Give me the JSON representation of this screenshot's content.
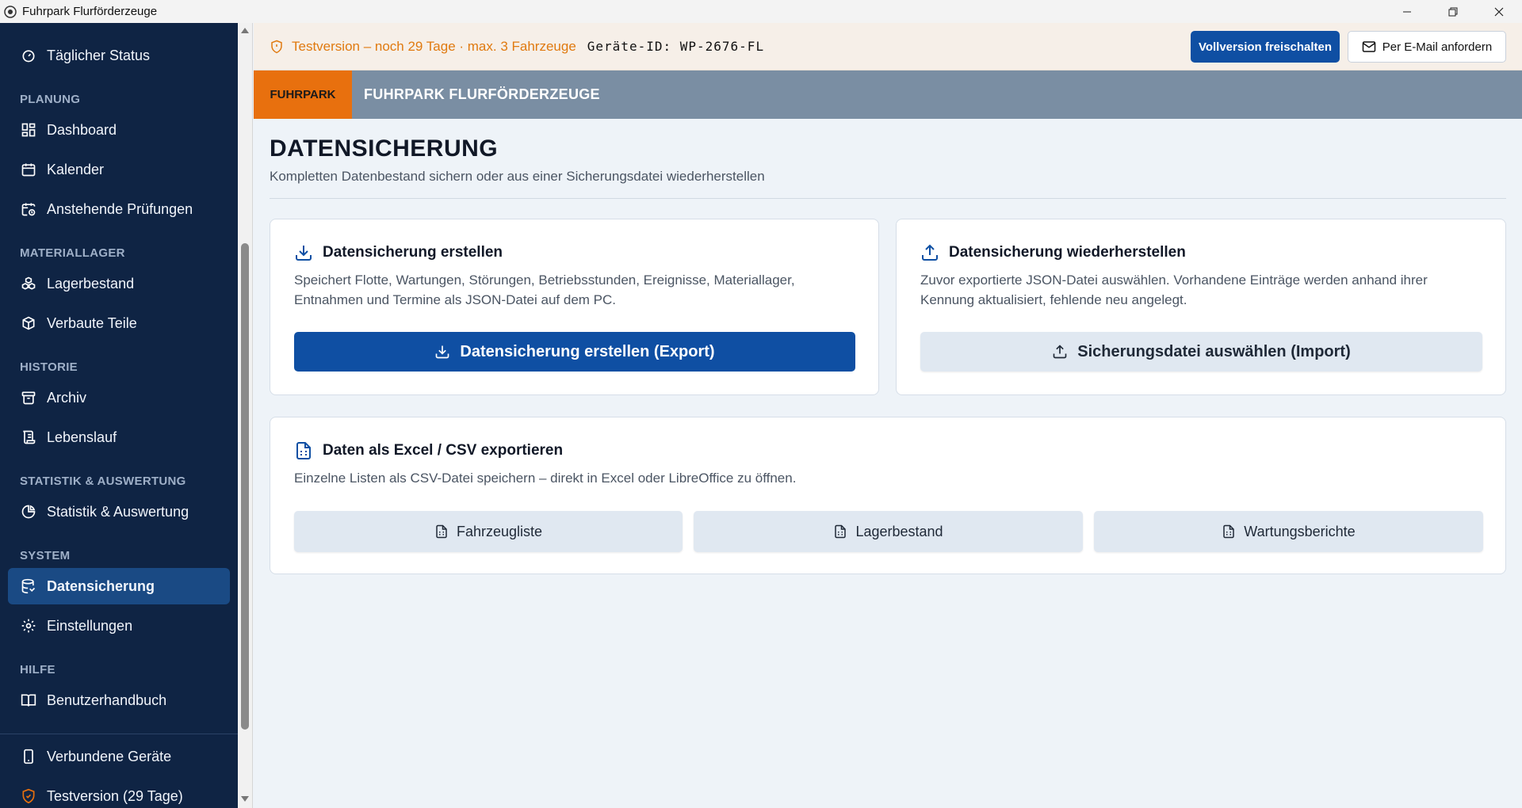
{
  "window": {
    "title": "Fuhrpark Flurförderzeuge",
    "minimize": "—",
    "restore": "❐",
    "close": "✕"
  },
  "sidebar": {
    "items_top": [
      {
        "label": "Täglicher Status",
        "icon": "gauge-icon"
      }
    ],
    "sections": [
      {
        "title": "PLANUNG",
        "items": [
          {
            "label": "Dashboard",
            "icon": "dashboard-icon"
          },
          {
            "label": "Kalender",
            "icon": "calendar-icon"
          },
          {
            "label": "Anstehende Prüfungen",
            "icon": "calendar-clock-icon"
          }
        ]
      },
      {
        "title": "MATERIALLAGER",
        "items": [
          {
            "label": "Lagerbestand",
            "icon": "boxes-icon"
          },
          {
            "label": "Verbaute Teile",
            "icon": "package-icon"
          }
        ]
      },
      {
        "title": "HISTORIE",
        "items": [
          {
            "label": "Archiv",
            "icon": "archive-icon"
          },
          {
            "label": "Lebenslauf",
            "icon": "scroll-icon"
          }
        ]
      },
      {
        "title": "STATISTIK & AUSWERTUNG",
        "items": [
          {
            "label": "Statistik & Auswertung",
            "icon": "pie-chart-icon"
          }
        ]
      },
      {
        "title": "SYSTEM",
        "items": [
          {
            "label": "Datensicherung",
            "icon": "database-backup-icon",
            "active": true
          },
          {
            "label": "Einstellungen",
            "icon": "gear-icon"
          }
        ]
      },
      {
        "title": "HILFE",
        "items": [
          {
            "label": "Benutzerhandbuch",
            "icon": "book-icon"
          }
        ]
      }
    ],
    "footer": [
      {
        "label": "Verbundene Geräte",
        "icon": "phone-icon"
      },
      {
        "label": "Testversion (29 Tage)",
        "icon": "shield-icon"
      }
    ]
  },
  "trial": {
    "text": "Testversion – noch 29 Tage · max. 3 Fahrzeuge",
    "device_id": "Geräte-ID: WP-2676-FL",
    "unlock_label": "Vollversion freischalten",
    "email_label": "Per E-Mail anfordern",
    "accent": "#e07a10"
  },
  "header": {
    "brand": "FUHRPARK",
    "title": "FUHRPARK FLURFÖRDERZEUGE",
    "brand_color": "#e8700e"
  },
  "page": {
    "title": "DATENSICHERUNG",
    "subtitle": "Kompletten Datenbestand sichern oder aus einer Sicherungsdatei wiederherstellen"
  },
  "export_card": {
    "title": "Datensicherung erstellen",
    "desc_line1": "Speichert Flotte, Wartungen, Störungen, Betriebsstunden, Ereignisse, Materiallager,",
    "desc_line2": "Entnahmen und Termine als JSON-Datei auf dem PC.",
    "button": "Datensicherung erstellen (Export)"
  },
  "import_card": {
    "title": "Datensicherung wiederherstellen",
    "desc_line1": "Zuvor exportierte JSON-Datei auswählen. Vorhandene Einträge werden anhand ihrer",
    "desc_line2": "Kennung aktualisiert, fehlende neu angelegt.",
    "button": "Sicherungsdatei auswählen (Import)"
  },
  "csv_card": {
    "title": "Daten als Excel / CSV exportieren",
    "desc": "Einzelne Listen als CSV-Datei speichern – direkt in Excel oder LibreOffice zu öffnen.",
    "buttons": [
      "Fahrzeugliste",
      "Lagerbestand",
      "Wartungsberichte"
    ]
  },
  "colors": {
    "sidebar_bg": "#0f2444",
    "active_item": "#1a4a84",
    "primary": "#0f4fa3"
  }
}
